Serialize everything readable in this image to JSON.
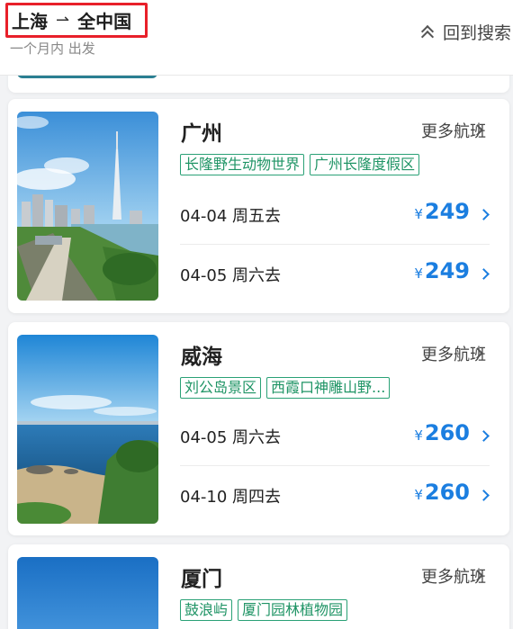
{
  "header": {
    "origin": "上海",
    "destination": "全中国",
    "timeframe": "一个月内 出发",
    "back_to_search": "回到搜索"
  },
  "cards": [
    {
      "city": "广州",
      "more_flights": "更多航班",
      "tags": [
        "长隆野生动物世界",
        "广州长隆度假区"
      ],
      "image_icon": "guangzhou-canton-tower-photo",
      "flights": [
        {
          "date": "04-04 周五去",
          "currency": "¥",
          "price": "249"
        },
        {
          "date": "04-05 周六去",
          "currency": "¥",
          "price": "249"
        }
      ]
    },
    {
      "city": "威海",
      "more_flights": "更多航班",
      "tags": [
        "刘公岛景区",
        "西霞口神雕山野..."
      ],
      "image_icon": "weihai-coastline-photo",
      "flights": [
        {
          "date": "04-05 周六去",
          "currency": "¥",
          "price": "260"
        },
        {
          "date": "04-10 周四去",
          "currency": "¥",
          "price": "260"
        }
      ]
    },
    {
      "city": "厦门",
      "more_flights": "更多航班",
      "tags": [
        "鼓浪屿",
        "厦门园林植物园"
      ],
      "image_icon": "xiamen-sky-photo",
      "flights": []
    }
  ],
  "colors": {
    "highlight_box": "#e8202a",
    "tag_green": "#2aa176",
    "price_blue": "#1b7ee0"
  }
}
